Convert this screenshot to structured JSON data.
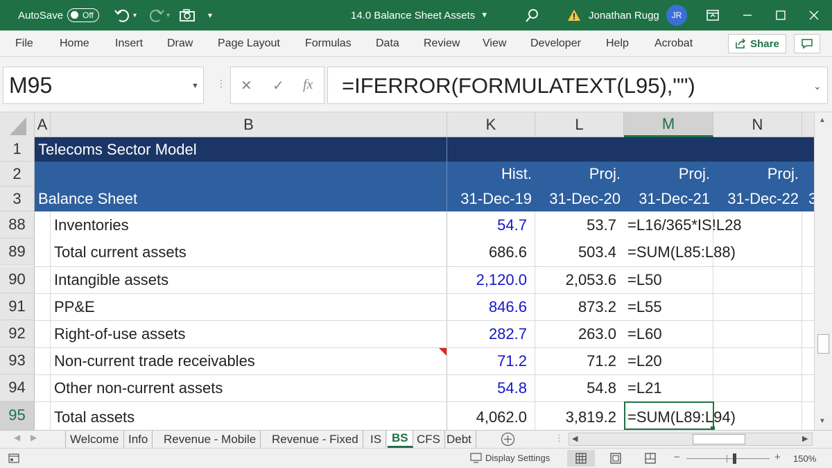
{
  "titlebar": {
    "autosave_label": "AutoSave",
    "autosave_state": "Off",
    "document_title": "14.0 Balance Sheet Assets",
    "warning_icon": "warning-icon",
    "user_name": "Jonathan Rugg",
    "user_initials": "JR"
  },
  "ribbon": {
    "tabs": [
      "File",
      "Home",
      "Insert",
      "Draw",
      "Page Layout",
      "Formulas",
      "Data",
      "Review",
      "View",
      "Developer",
      "Help",
      "Acrobat"
    ],
    "share_label": "Share"
  },
  "formula_bar": {
    "name_box": "M95",
    "fx_label": "fx",
    "formula": "=IFERROR(FORMULATEXT(L95),\"\")"
  },
  "columns": [
    {
      "key": "A",
      "label": "A"
    },
    {
      "key": "B",
      "label": "B"
    },
    {
      "key": "K",
      "label": "K"
    },
    {
      "key": "L",
      "label": "L"
    },
    {
      "key": "M",
      "label": "M"
    },
    {
      "key": "N",
      "label": "N"
    }
  ],
  "header_rows": {
    "row1": {
      "num": "1",
      "title": "Telecoms Sector Model"
    },
    "row2": {
      "num": "2",
      "K": "Hist.",
      "L": "Proj.",
      "M": "Proj.",
      "N": "Proj."
    },
    "row3": {
      "num": "3",
      "label": "Balance Sheet",
      "K": "31-Dec-19",
      "L": "31-Dec-20",
      "M": "31-Dec-21",
      "N": "31-Dec-22",
      "O": "3"
    }
  },
  "rows": [
    {
      "num": "88",
      "label": "Inventories",
      "K": "54.7",
      "L": "53.7",
      "M": "=L16/365*IS!L28"
    },
    {
      "num": "89",
      "label": "Total current assets",
      "K": "686.6",
      "L": "503.4",
      "M": "=SUM(L85:L88)"
    },
    {
      "num": "90",
      "label": "Intangible assets",
      "K": "2,120.0",
      "L": "2,053.6",
      "M": "=L50"
    },
    {
      "num": "91",
      "label": "PP&E",
      "K": "846.6",
      "L": "873.2",
      "M": "=L55"
    },
    {
      "num": "92",
      "label": "Right-of-use assets",
      "K": "282.7",
      "L": "263.0",
      "M": "=L60"
    },
    {
      "num": "93",
      "label": "Non-current trade receivables",
      "K": "71.2",
      "L": "71.2",
      "M": "=L20"
    },
    {
      "num": "94",
      "label": "Other non-current assets",
      "K": "54.8",
      "L": "54.8",
      "M": "=L21"
    },
    {
      "num": "95",
      "label": "Total assets",
      "K": "4,062.0",
      "L": "3,819.2",
      "M": "=SUM(L89:L94)"
    }
  ],
  "sheet_tabs": [
    "Welcome",
    "Info",
    "Revenue - Mobile",
    "Revenue - Fixed",
    "IS",
    "BS",
    "CFS",
    "Debt"
  ],
  "active_sheet": "BS",
  "status_bar": {
    "display_settings": "Display Settings",
    "zoom": "150%"
  },
  "colors": {
    "excel_green": "#1f7145",
    "header_dark": "#1a3566",
    "header_mid": "#2e5f9e",
    "input_blue": "#1616c8"
  }
}
